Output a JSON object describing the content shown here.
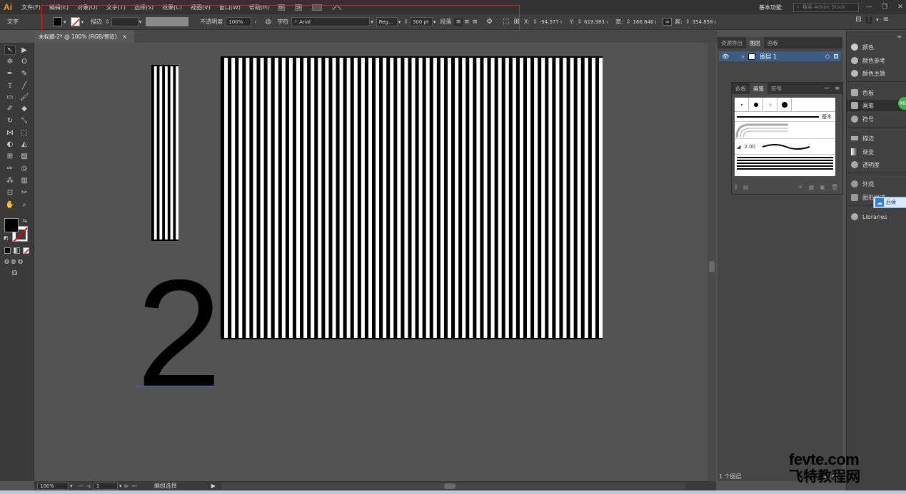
{
  "app": {
    "logo": "Ai"
  },
  "menu": [
    "文件(F)",
    "编辑(E)",
    "对象(O)",
    "文字(T)",
    "选择(S)",
    "效果(C)",
    "视图(V)",
    "窗口(W)",
    "帮助(H)"
  ],
  "menubar": {
    "br_label": "Br",
    "st_label": "St",
    "workspace": "基本功能",
    "stock_placeholder": "搜索 Adobe Stock"
  },
  "control": {
    "mode_label": "文字",
    "stroke_label": "描边",
    "opacity_label": "不透明度",
    "opacity_value": "100%",
    "char_label": "字符",
    "font_family": "Arial",
    "font_style": "Reg...",
    "font_size": "300 pt",
    "para_label": "段落",
    "x_label": "X:",
    "x_value": "-94.577 ı",
    "y_label": "Y:",
    "y_value": "619.983 ı",
    "w_label": "宽:",
    "w_value": "166.846 ı",
    "h_label": "高:",
    "h_value": "354.858 ı"
  },
  "document": {
    "tab_title": "未标题-2* @ 100% (RGB/预览)",
    "close": "×"
  },
  "canvas": {
    "digit": "2",
    "small_stripes": 10,
    "large_stripes": 106
  },
  "status": {
    "zoom": "100%",
    "page": "1",
    "tool": "编组选择"
  },
  "layers_panel": {
    "tabs": [
      "资源导出",
      "图层",
      "画板"
    ],
    "active_tab": 1,
    "layer_name": "图层 1",
    "footer": "1 个图层"
  },
  "brush_panel": {
    "tabs": [
      "色板",
      "画笔",
      "符号"
    ],
    "active_tab": 1,
    "basic_label": "基本",
    "size_label": "2.00"
  },
  "dock": {
    "items": [
      "颜色",
      "颜色参考",
      "颜色主题",
      "色板",
      "画笔",
      "符号",
      "描边",
      "渐变",
      "透明度",
      "外观",
      "图形样式",
      "Libraries"
    ],
    "badge": "46",
    "tooltip": "后续"
  },
  "watermark": {
    "line1": "fevte.com",
    "line2": "飞特教程网"
  }
}
